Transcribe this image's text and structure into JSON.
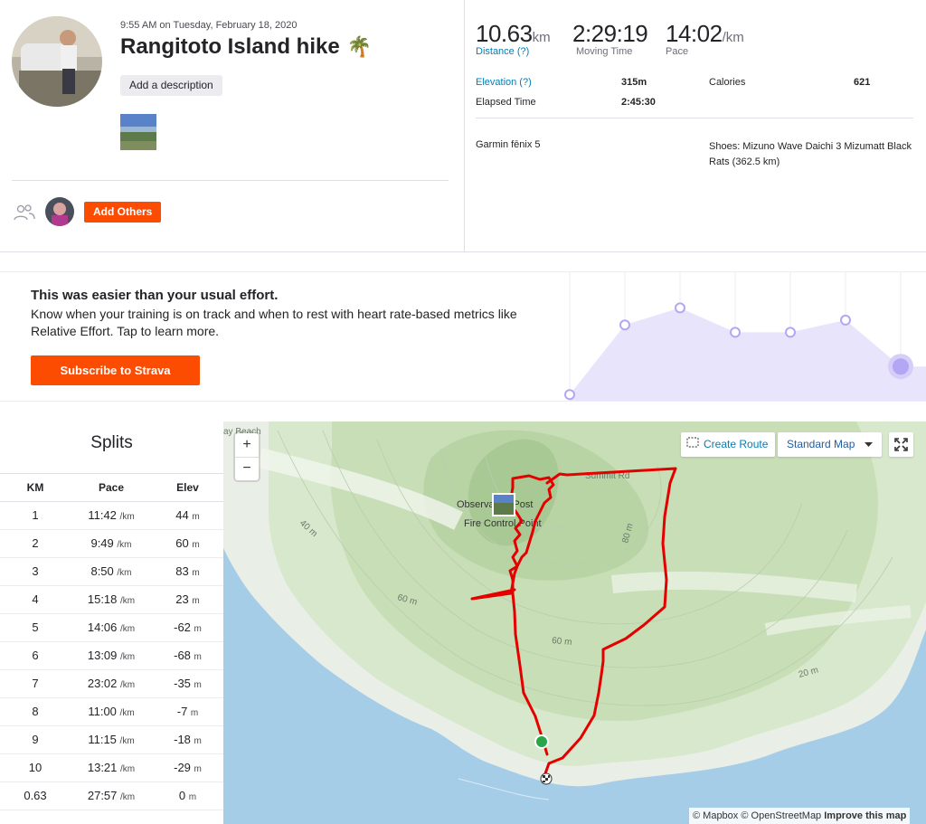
{
  "activity": {
    "date_text": "9:55 AM on Tuesday, February 18, 2020",
    "title": "Rangitoto Island hike",
    "title_emoji": "🌴",
    "add_description": "Add a description",
    "add_others": "Add Others"
  },
  "stats": {
    "distance": {
      "value": "10.63",
      "unit": "km",
      "label": "Distance (?)"
    },
    "moving_time": {
      "value": "2:29:19",
      "label": "Moving Time"
    },
    "pace": {
      "value": "14:02",
      "unit": "/km",
      "label": "Pace"
    },
    "elevation": {
      "label": "Elevation (?)",
      "value": "315m"
    },
    "calories": {
      "label": "Calories",
      "value": "621"
    },
    "elapsed": {
      "label": "Elapsed Time",
      "value": "2:45:30"
    },
    "device": "Garmin fēnix 5",
    "shoes": "Shoes: Mizuno Wave Daichi 3 Mizumatt Black Rats (362.5 km)"
  },
  "effort": {
    "title": "This was easier than your usual effort.",
    "text": "Know when your training is on track and when to rest with heart rate-based metrics like Relative Effort. Tap to learn more.",
    "subscribe": "Subscribe to Strava",
    "trend_values": [
      0.05,
      0.62,
      0.76,
      0.56,
      0.56,
      0.66,
      0.28
    ]
  },
  "splits": {
    "title": "Splits",
    "headers": [
      "KM",
      "Pace",
      "Elev"
    ],
    "pace_unit": "/km",
    "elev_unit": "m",
    "rows": [
      {
        "km": "1",
        "pace": "11:42",
        "elev": "44"
      },
      {
        "km": "2",
        "pace": "9:49",
        "elev": "60"
      },
      {
        "km": "3",
        "pace": "8:50",
        "elev": "83"
      },
      {
        "km": "4",
        "pace": "15:18",
        "elev": "23"
      },
      {
        "km": "5",
        "pace": "14:06",
        "elev": "-62"
      },
      {
        "km": "6",
        "pace": "13:09",
        "elev": "-68"
      },
      {
        "km": "7",
        "pace": "23:02",
        "elev": "-35"
      },
      {
        "km": "8",
        "pace": "11:00",
        "elev": "-7"
      },
      {
        "km": "9",
        "pace": "11:15",
        "elev": "-18"
      },
      {
        "km": "10",
        "pace": "13:21",
        "elev": "-29"
      },
      {
        "km": "0.63",
        "pace": "27:57",
        "elev": "0"
      }
    ]
  },
  "map": {
    "zoom_in": "+",
    "zoom_out": "−",
    "create_route": "Create Route",
    "map_style": "Standard Map",
    "attribution_mapbox": "© Mapbox",
    "attribution_osm": "© OpenStreetMap",
    "attribution_improve": "Improve this map",
    "labels": {
      "beach": "ay Beach",
      "observation": "Observation Post",
      "fire_control": "Fire Control Point",
      "summit_rd": "Summit Rd",
      "c40": "40 m",
      "c60a": "60 m",
      "c60b": "60 m",
      "c80": "80 m",
      "c20": "20 m"
    }
  },
  "colors": {
    "brand": "#fc4c02",
    "link": "#007fb6",
    "route": "#e50000",
    "effort_fill": "#e8e4fb",
    "effort_dot": "#b3a6f4"
  }
}
